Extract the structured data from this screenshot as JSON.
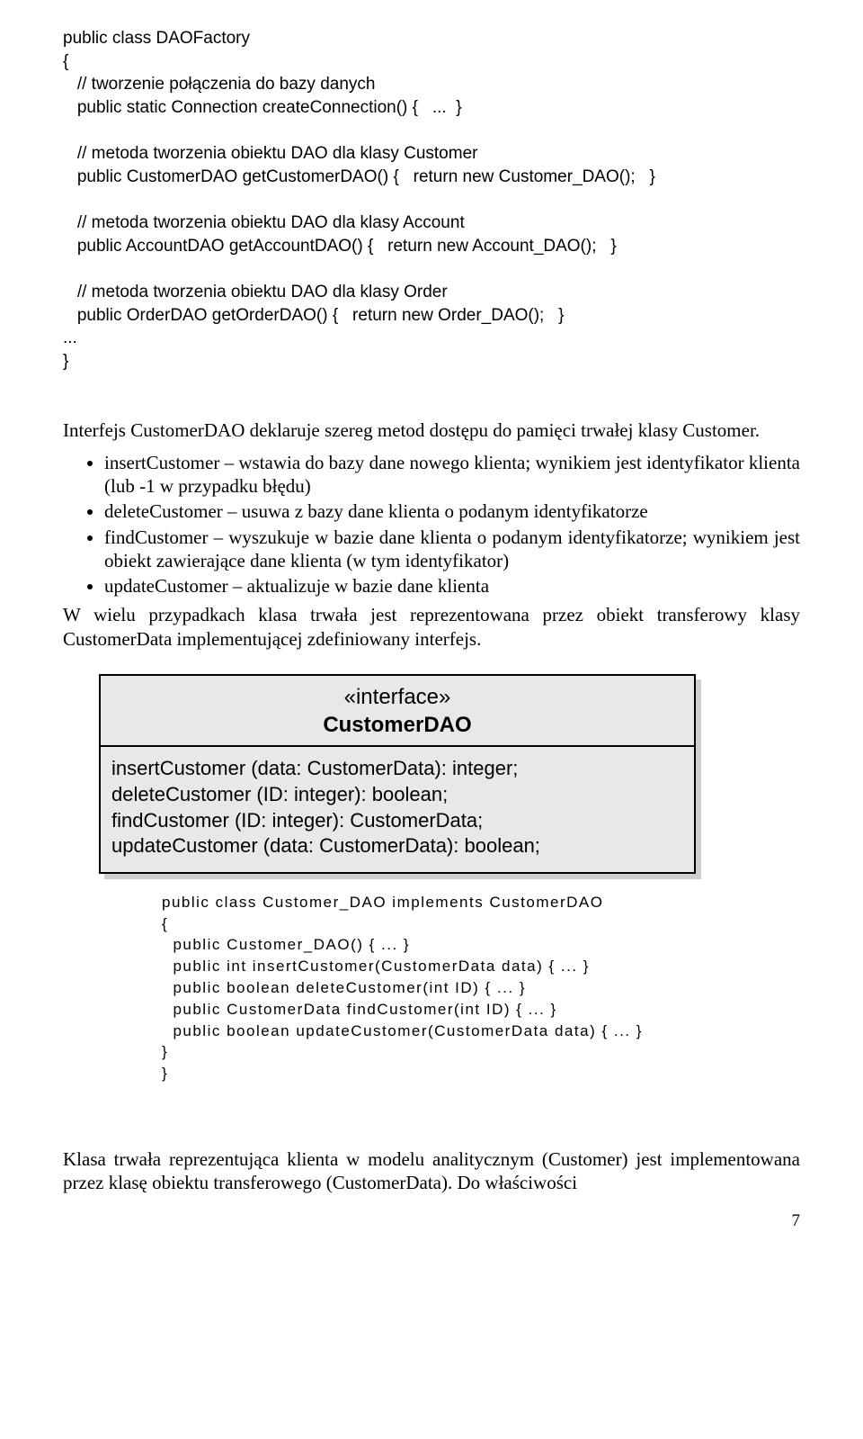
{
  "code1": {
    "l1": "public class DAOFactory",
    "l2": "{",
    "l3": "   // tworzenie połączenia do bazy danych",
    "l4": "   public static Connection createConnection() {   ...  }",
    "l5": "",
    "l6": "   // metoda tworzenia obiektu DAO dla klasy Customer",
    "l7": "   public CustomerDAO getCustomerDAO() {   return new Customer_DAO();   }",
    "l8": "",
    "l9": "   // metoda tworzenia obiektu DAO dla klasy Account",
    "l10": "   public AccountDAO getAccountDAO() {   return new Account_DAO();   }",
    "l11": "",
    "l12": "   // metoda tworzenia obiektu DAO dla klasy Order",
    "l13": "   public OrderDAO getOrderDAO() {   return new Order_DAO();   }",
    "l14": "...",
    "l15": "}"
  },
  "intro": "Interfejs CustomerDAO deklaruje szereg metod dostępu do pamięci trwałej klasy Customer.",
  "bullets": {
    "b1": "insertCustomer – wstawia do bazy dane nowego klienta; wynikiem jest identyfikator klienta (lub -1 w przypadku błędu)",
    "b2": "deleteCustomer – usuwa z bazy dane klienta o podanym identyfikatorze",
    "b3": "findCustomer – wyszukuje w bazie dane klienta o podanym identyfikatorze; wynikiem jest obiekt zawierające dane klienta (w tym identyfikator)",
    "b4": "updateCustomer – aktualizuje w bazie dane klienta"
  },
  "after_list": "W wielu przypadkach klasa trwała jest reprezentowana przez obiekt transferowy klasy CustomerData implementującej zdefiniowany interfejs.",
  "uml": {
    "stereotype": "«interface»",
    "name": "CustomerDAO",
    "op1": "insertCustomer (data: CustomerData): integer;",
    "op2": "deleteCustomer (ID: integer): boolean;",
    "op3": "findCustomer (ID: integer): CustomerData;",
    "op4": "updateCustomer (data: CustomerData): boolean;"
  },
  "code2": {
    "l1": "public class Customer_DAO implements CustomerDAO",
    "l2": "{",
    "l3": "  public Customer_DAO() { ... }",
    "l4": "  public int insertCustomer(CustomerData data) { ... }",
    "l5": "  public boolean deleteCustomer(int ID) { ... }",
    "l6": "  public CustomerData findCustomer(int ID) { ... }",
    "l7": "  public boolean updateCustomer(CustomerData data) { ... }",
    "l8": "}",
    "l9": "}"
  },
  "closing": "Klasa trwała reprezentująca klienta w modelu analitycznym (Customer) jest implementowana przez klasę obiektu transferowego (CustomerData). Do właściwości",
  "page_number": "7"
}
